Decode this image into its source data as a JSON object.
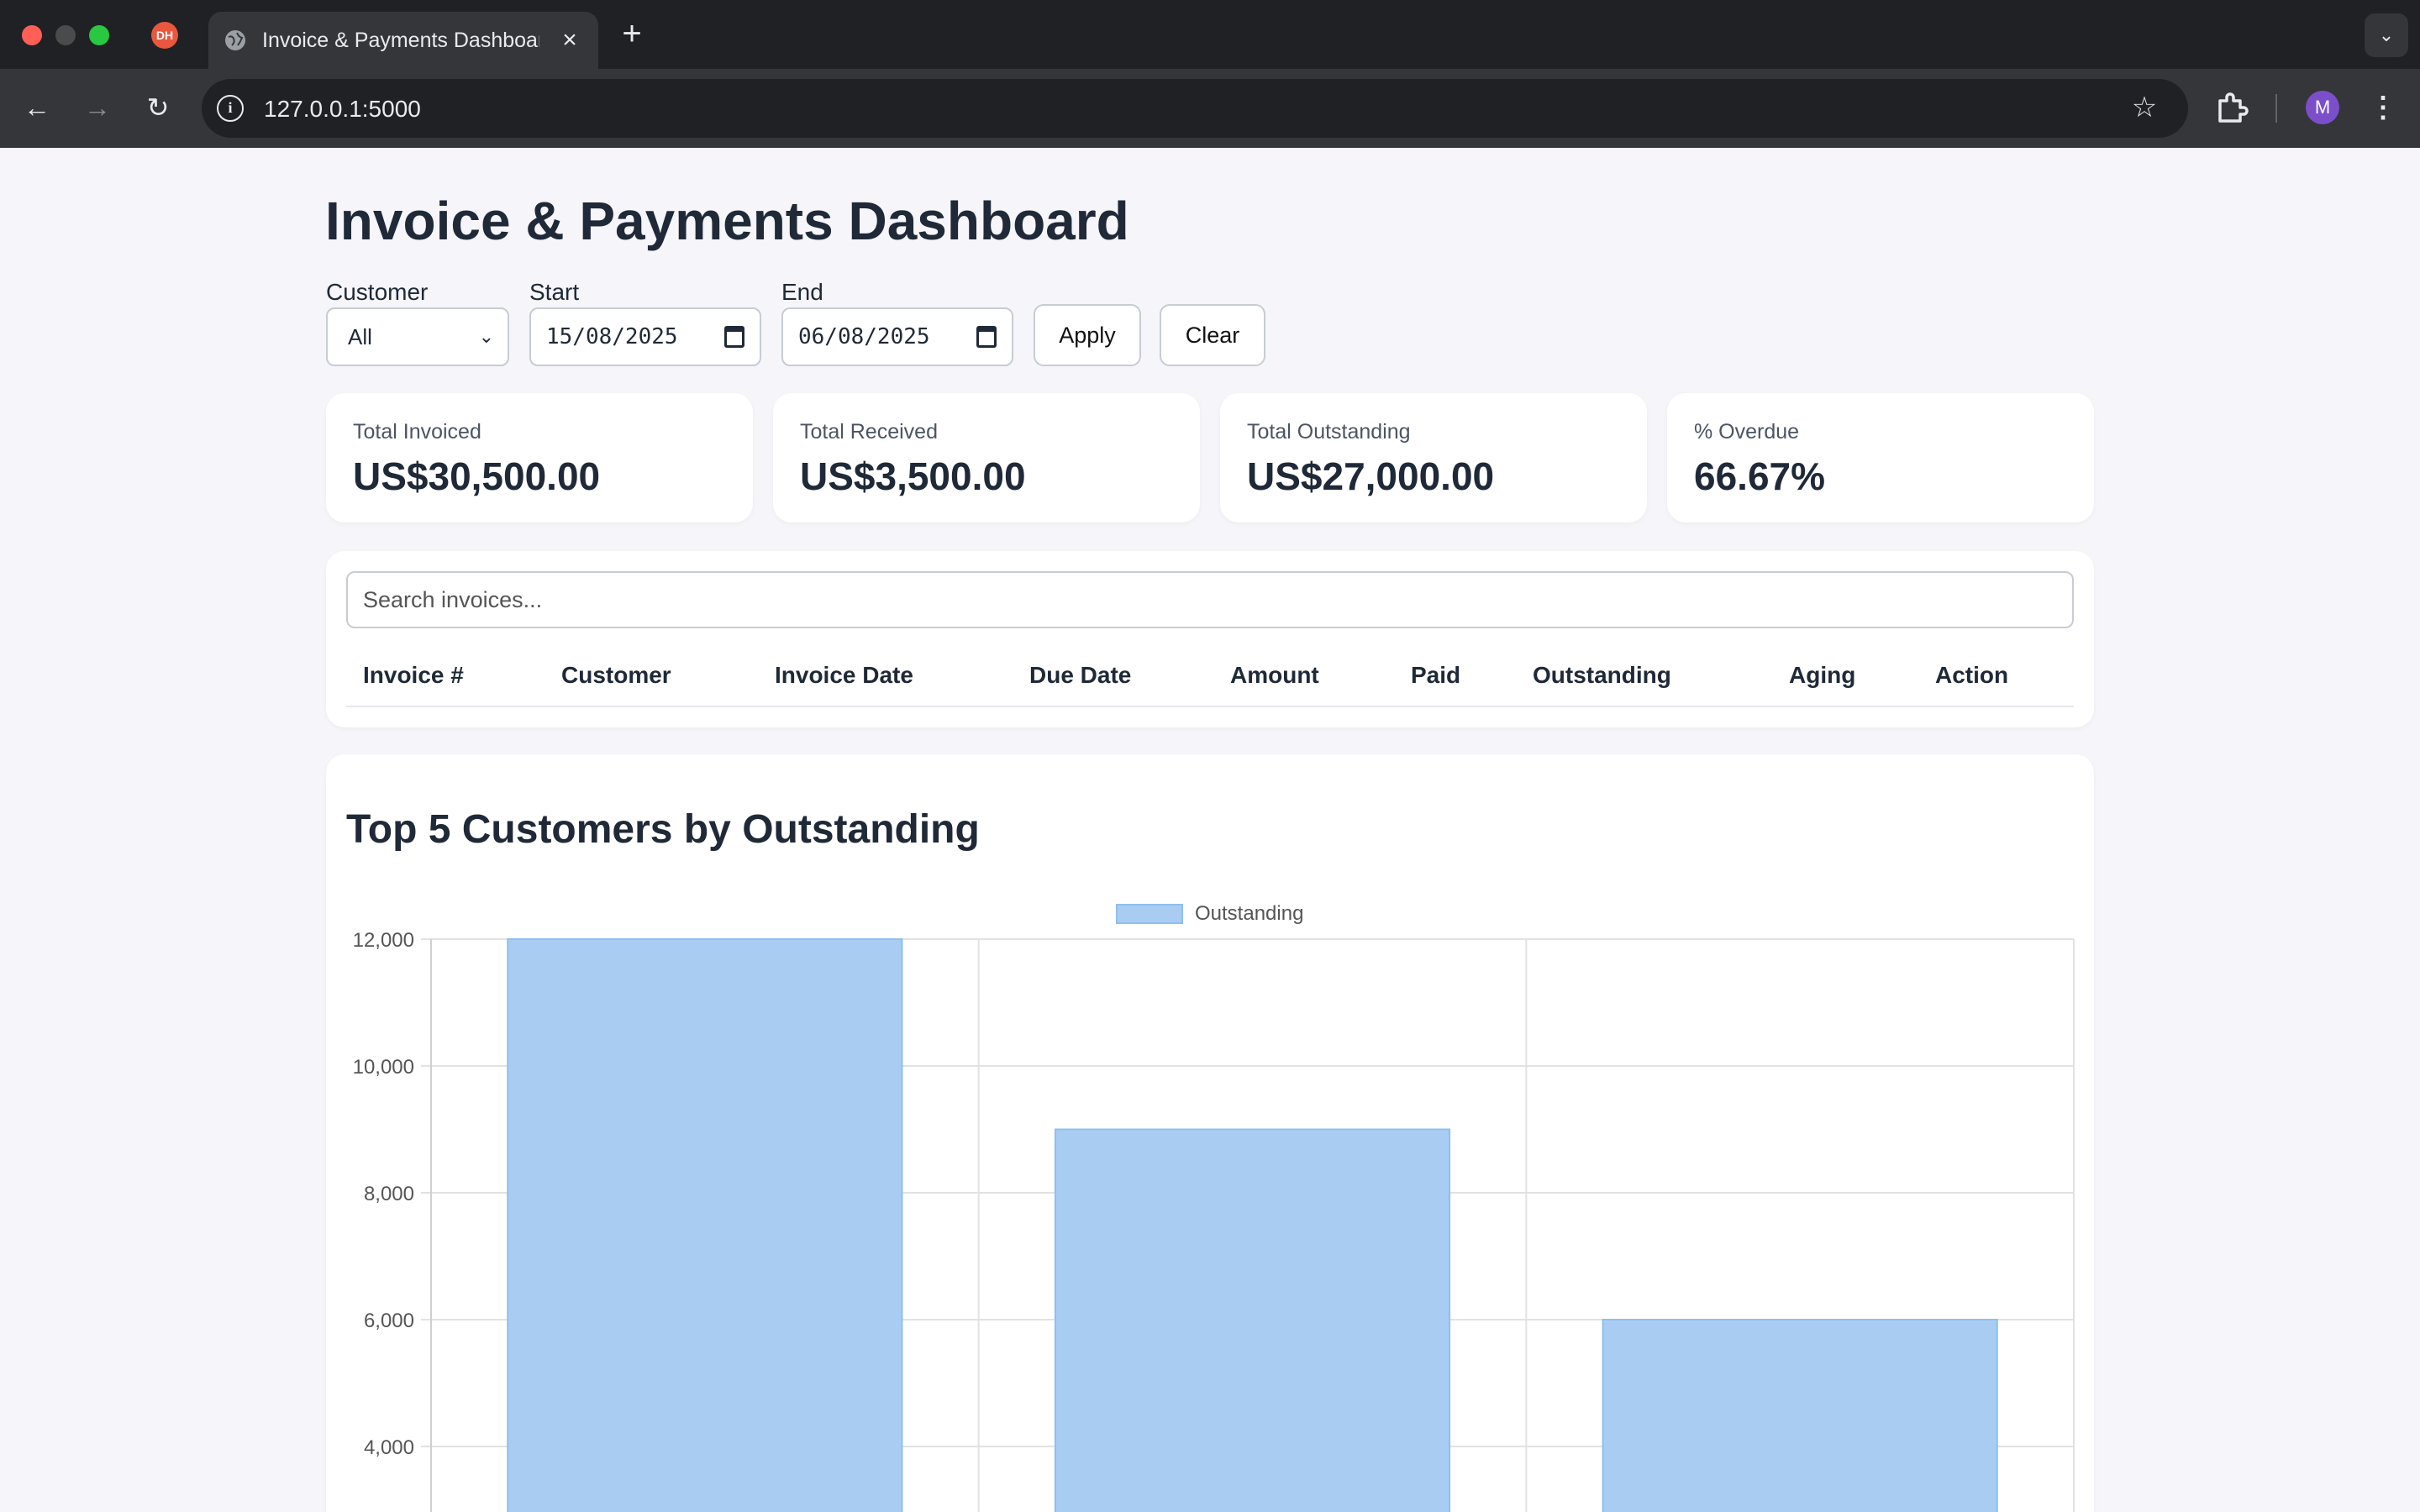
{
  "browser": {
    "tab_title": "Invoice & Payments Dashboard",
    "pinned_tab_initials": "DH",
    "url": "127.0.0.1:5000",
    "profile_initial": "M"
  },
  "page": {
    "title": "Invoice & Payments Dashboard"
  },
  "filters": {
    "customer_label": "Customer",
    "customer_value": "All",
    "start_label": "Start",
    "start_value": "15/08/2025",
    "end_label": "End",
    "end_value": "06/08/2025",
    "apply_label": "Apply",
    "clear_label": "Clear"
  },
  "kpis": [
    {
      "label": "Total Invoiced",
      "value": "US$30,500.00"
    },
    {
      "label": "Total Received",
      "value": "US$3,500.00"
    },
    {
      "label": "Total Outstanding",
      "value": "US$27,000.00"
    },
    {
      "label": "% Overdue",
      "value": "66.67%"
    }
  ],
  "invoices": {
    "search_placeholder": "Search invoices...",
    "columns": [
      "Invoice #",
      "Customer",
      "Invoice Date",
      "Due Date",
      "Amount",
      "Paid",
      "Outstanding",
      "Aging",
      "Action"
    ],
    "rows": []
  },
  "chart_section": {
    "title": "Top 5 Customers by Outstanding"
  },
  "colors": {
    "bar_fill": "#a9cdf2",
    "bar_stroke": "#8fbfee",
    "page_bg": "#f5f5fa",
    "text": "#1f2937"
  },
  "chart_data": {
    "type": "bar",
    "legend": [
      "Outstanding"
    ],
    "legend_position": "top-center",
    "grid": true,
    "series": [
      {
        "name": "Outstanding",
        "values": [
          12000,
          9000,
          6000
        ]
      }
    ],
    "y_ticks": [
      "12,000",
      "10,000",
      "8,000",
      "6,000",
      "4,000"
    ],
    "y_tick_values": [
      12000,
      10000,
      8000,
      6000,
      4000
    ],
    "ylim": [
      0,
      12000
    ]
  }
}
